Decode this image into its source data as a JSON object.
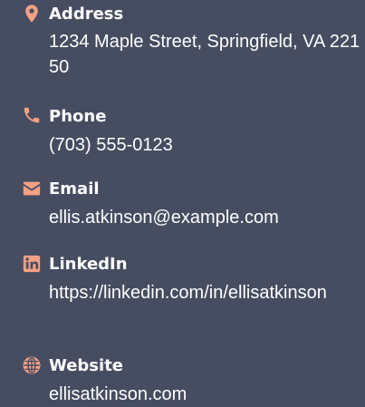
{
  "colors": {
    "background": "#474d61",
    "icon": "#f4a184",
    "text": "#ffffff"
  },
  "contacts": [
    {
      "icon": "map-pin-icon",
      "label": "Address",
      "value": "1234 Maple Street, Springfield, VA 22150"
    },
    {
      "icon": "phone-icon",
      "label": "Phone",
      "value": "(703) 555-0123"
    },
    {
      "icon": "envelope-icon",
      "label": "Email",
      "value": "ellis.atkinson@example.com"
    },
    {
      "icon": "linkedin-icon",
      "label": "LinkedIn",
      "value": "https://linkedin.com/in/ellisatkinson"
    },
    {
      "icon": "globe-icon",
      "label": "Website",
      "value": "ellisatkinson.com"
    }
  ]
}
